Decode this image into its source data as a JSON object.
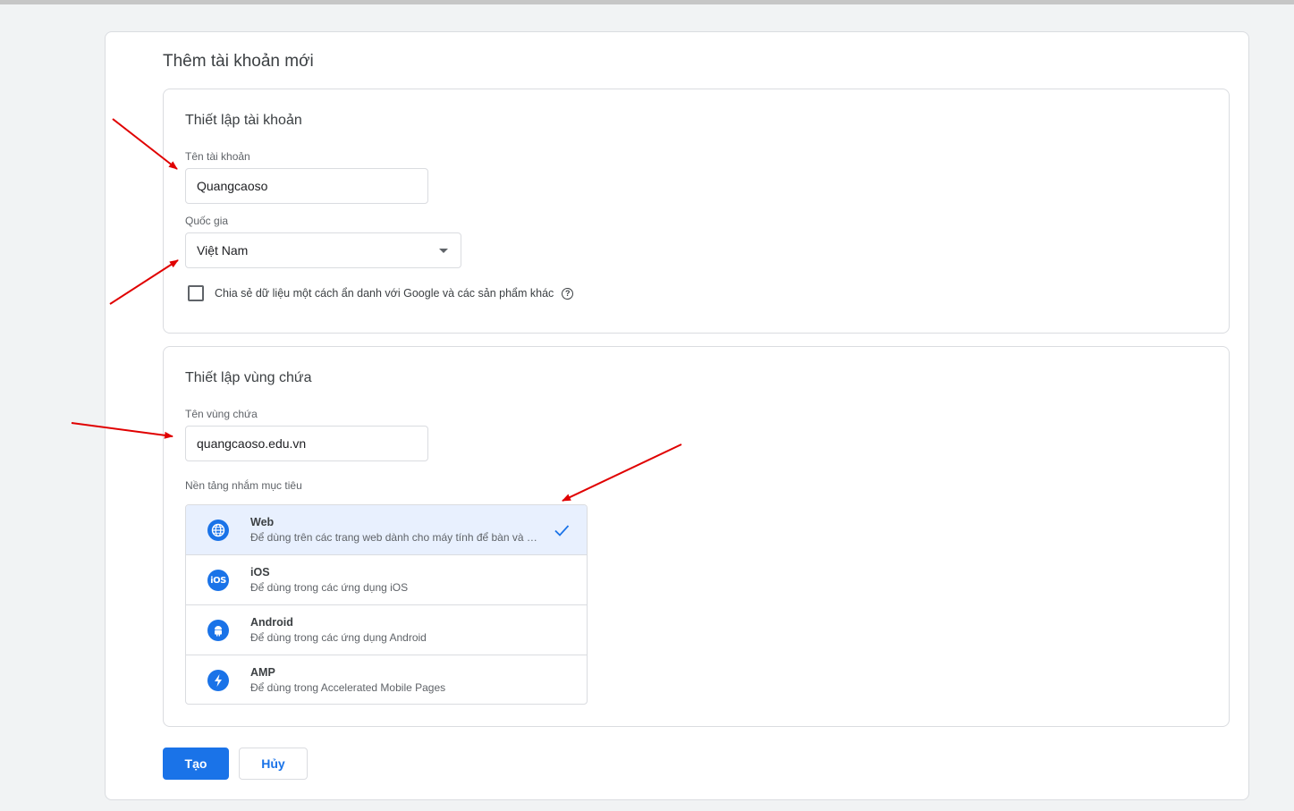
{
  "page": {
    "title": "Thêm tài khoản mới"
  },
  "account_setup": {
    "title": "Thiết lập tài khoản",
    "account_name_label": "Tên tài khoản",
    "account_name_value": "Quangcaoso",
    "country_label": "Quốc gia",
    "country_value": "Việt Nam",
    "share_data_label": "Chia sẻ dữ liệu một cách ẩn danh với Google và các sản phẩm khác",
    "share_data_checked": false
  },
  "container_setup": {
    "title": "Thiết lập vùng chứa",
    "container_name_label": "Tên vùng chứa",
    "container_name_value": "quangcaoso.edu.vn",
    "platform_label": "Nền tảng nhắm mục tiêu",
    "platforms": [
      {
        "name": "Web",
        "desc": "Để dùng trên các trang web dành cho máy tính để bàn và thiết bị di động",
        "icon": "globe-icon",
        "selected": true
      },
      {
        "name": "iOS",
        "desc": "Để dùng trong các ứng dụng iOS",
        "icon": "ios-icon",
        "selected": false
      },
      {
        "name": "Android",
        "desc": "Để dùng trong các ứng dụng Android",
        "icon": "android-icon",
        "selected": false
      },
      {
        "name": "AMP",
        "desc": "Để dùng trong Accelerated Mobile Pages",
        "icon": "bolt-icon",
        "selected": false
      }
    ]
  },
  "actions": {
    "create_label": "Tạo",
    "cancel_label": "Hủy"
  },
  "colors": {
    "primary": "#1a73e8",
    "selected_bg": "#e8f0fe",
    "annotation_arrow": "#e00000"
  }
}
